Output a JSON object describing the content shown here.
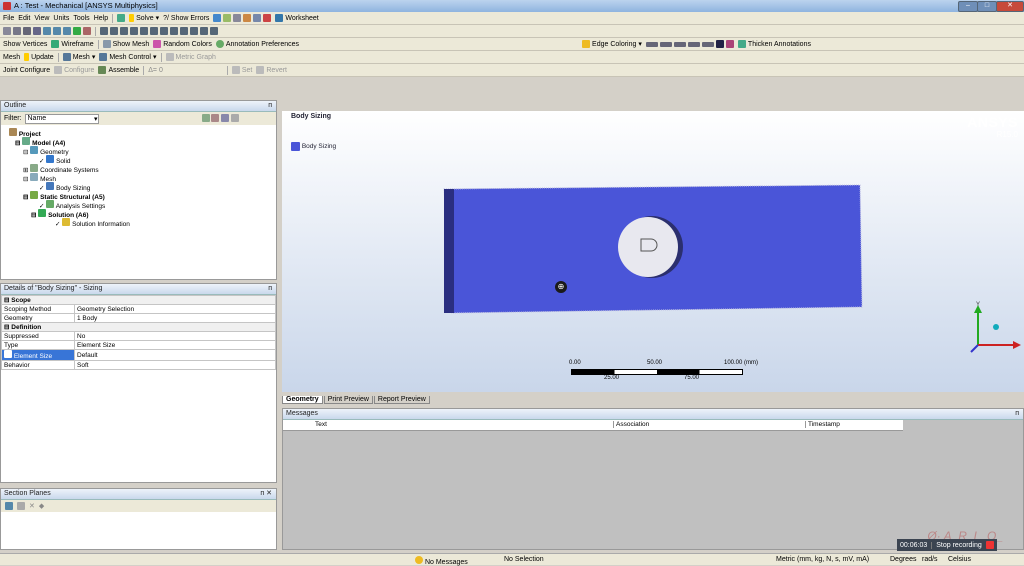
{
  "window": {
    "title": "A : Test - Mechanical [ANSYS Multiphysics]"
  },
  "menu": [
    "File",
    "Edit",
    "View",
    "Units",
    "Tools",
    "Help"
  ],
  "toolbar1": {
    "solve": "Solve",
    "show_errors": "?/ Show Errors",
    "worksheet": "Worksheet"
  },
  "toolbar2": {
    "show_vertices": "Show Vertices",
    "wireframe": "Wireframe",
    "show_mesh": "Show Mesh",
    "random_colors": "Random Colors",
    "annotation_prefs": "Annotation Preferences",
    "edge_coloring": "Edge Coloring",
    "thicken": "Thicken Annotations"
  },
  "toolbar3": {
    "mesh": "Mesh",
    "update": "Update",
    "mesh_dd": "Mesh",
    "mesh_control": "Mesh Control",
    "metric_graph": "Metric Graph"
  },
  "toolbar4": {
    "joint_configure": "Joint Configure",
    "configure": "Configure",
    "assemble": "Assemble",
    "delta_value": "0",
    "set": "Set",
    "revert": "Revert"
  },
  "outline": {
    "header": "Outline",
    "filter_label": "Filter:",
    "filter_value": "Name",
    "tree": [
      "Project",
      "Model (A4)",
      "Geometry",
      "Solid",
      "Coordinate Systems",
      "Mesh",
      "Body Sizing",
      "Static Structural (A5)",
      "Analysis Settings",
      "Solution (A6)",
      "Solution Information"
    ]
  },
  "details": {
    "header": "Details of \"Body Sizing\" - Sizing",
    "scope": "Scope",
    "scoping_method_label": "Scoping Method",
    "scoping_method_value": "Geometry Selection",
    "geometry_label": "Geometry",
    "geometry_value": "1 Body",
    "definition": "Definition",
    "suppressed_label": "Suppressed",
    "suppressed_value": "No",
    "type_label": "Type",
    "type_value": "Element Size",
    "element_size_label": "Element Size",
    "element_size_value": "Default",
    "behavior_label": "Behavior",
    "behavior_value": "Soft"
  },
  "section_planes": {
    "header": "Section Planes"
  },
  "viewport": {
    "title": "Body Sizing",
    "legend": "Body Sizing",
    "brand": "ANSYS",
    "version": "R15.0",
    "scale_top": [
      "0.00",
      "50.00",
      "100.00 (mm)"
    ],
    "scale_bottom": [
      "25.00",
      "75.00"
    ],
    "axis_y": "Y",
    "accent": "#4a55d8"
  },
  "tabs": [
    "Geometry",
    "Print Preview",
    "Report Preview"
  ],
  "messages": {
    "header": "Messages",
    "columns": [
      "Text",
      "Association",
      "Timestamp"
    ]
  },
  "recording": {
    "time": "00:06:03",
    "stop": "Stop recording"
  },
  "status": {
    "messages": "No Messages",
    "selection": "No Selection",
    "units": "Metric (mm, kg, N, s, mV, mA)",
    "degrees": "Degrees",
    "rads": "rad/s",
    "celsius": "Celsius"
  }
}
